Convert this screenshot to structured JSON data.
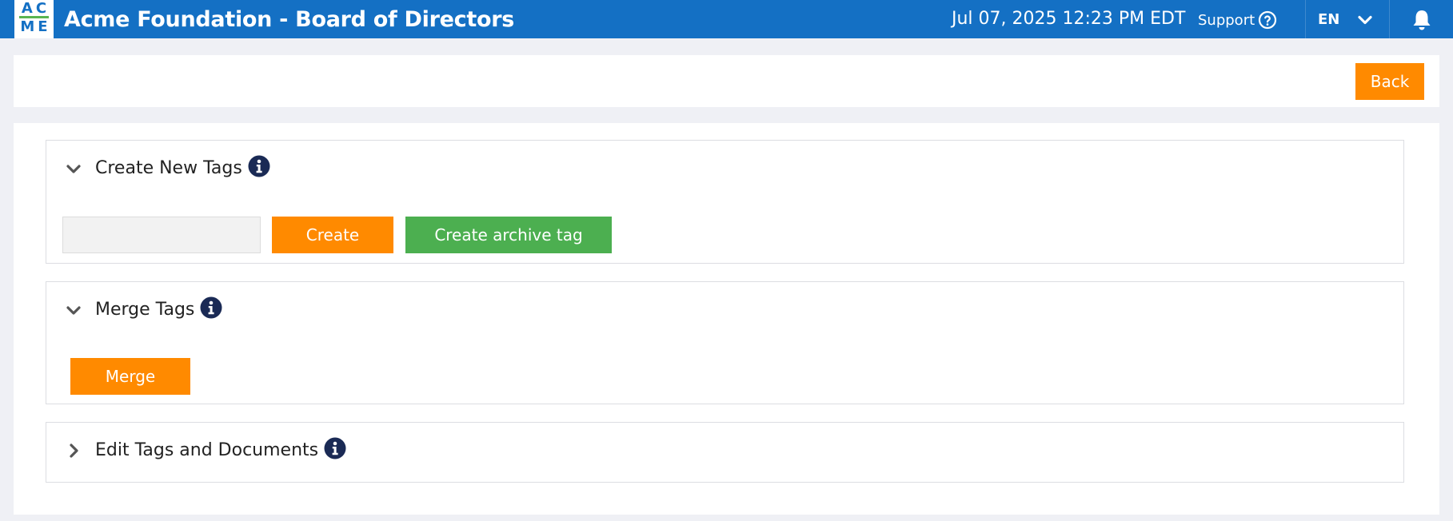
{
  "header": {
    "logo_top": "AC",
    "logo_bottom": "ME",
    "title": "Acme Foundation - Board of Directors",
    "datetime": "Jul 07, 2025 12:23 PM  EDT",
    "support_label": "Support",
    "language": "EN"
  },
  "toolbar": {
    "back_label": "Back"
  },
  "sections": {
    "create": {
      "title": "Create New Tags",
      "expanded": true,
      "input_value": "",
      "input_placeholder": "",
      "create_label": "Create",
      "archive_label": "Create archive tag"
    },
    "merge": {
      "title": "Merge Tags",
      "expanded": true,
      "merge_label": "Merge"
    },
    "edit": {
      "title": "Edit Tags and Documents",
      "expanded": false
    }
  },
  "colors": {
    "header_bg": "#1470c4",
    "orange": "#ff8a00",
    "green": "#4caf50",
    "info_icon": "#1a2a55",
    "logo_accent": "#59b450"
  },
  "icons": [
    "help-circle-icon",
    "chevron-down-icon",
    "bell-icon",
    "chevron-right-icon",
    "info-icon"
  ]
}
